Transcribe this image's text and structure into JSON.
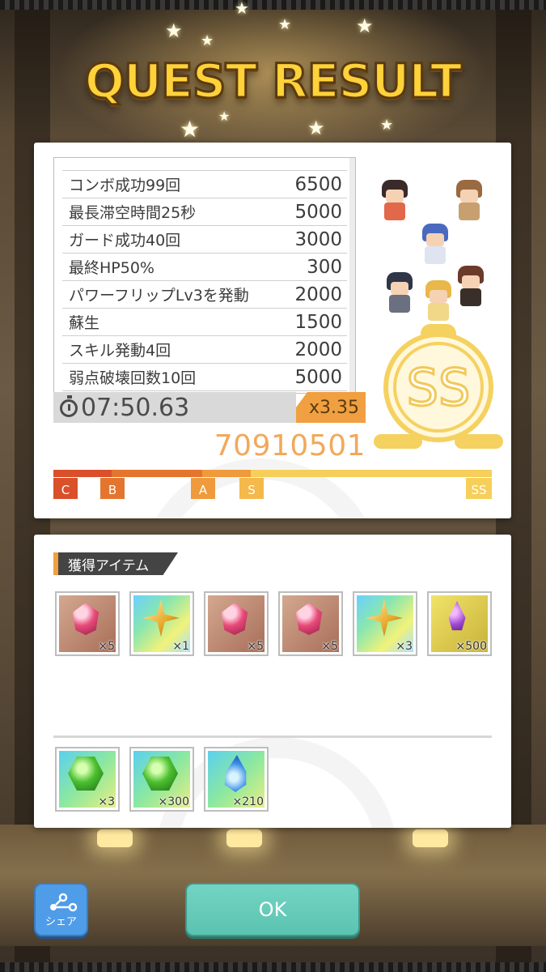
{
  "title": "QUEST RESULT",
  "score_entries": [
    {
      "label": "コンボ成功99回",
      "value": "6500"
    },
    {
      "label": "最長滞空時間25秒",
      "value": "5000"
    },
    {
      "label": "ガード成功40回",
      "value": "3000"
    },
    {
      "label": "最終HP50%",
      "value": "300"
    },
    {
      "label": "パワーフリップLv3を発動",
      "value": "2000"
    },
    {
      "label": "蘇生",
      "value": "1500"
    },
    {
      "label": "スキル発動4回",
      "value": "2000"
    },
    {
      "label": "弱点破壊回数10回",
      "value": "5000"
    }
  ],
  "clear_time": "07:50.63",
  "multiplier": "x3.35",
  "total_score": "70910501",
  "rank": {
    "achieved": "SS",
    "progress": 1.0,
    "levels": [
      "C",
      "B",
      "A",
      "S",
      "SS"
    ],
    "colors": {
      "C": "#d9502a",
      "B": "#e4752e",
      "A": "#ef9a3c",
      "S": "#f5b84a",
      "SS": "#f6cf5a"
    }
  },
  "items_section": {
    "label": "獲得アイテム",
    "items": [
      {
        "icon": "red-gem-icon",
        "tile": "brown",
        "count": "×5"
      },
      {
        "icon": "gold-star-icon",
        "tile": "rainbow",
        "count": "×1"
      },
      {
        "icon": "red-gem-icon",
        "tile": "brown",
        "count": "×5"
      },
      {
        "icon": "red-gem-icon",
        "tile": "brown",
        "count": "×5"
      },
      {
        "icon": "gold-star-icon",
        "tile": "rainbow",
        "count": "×3"
      },
      {
        "icon": "purple-gem-icon",
        "tile": "yellow",
        "count": "×500"
      }
    ],
    "extra_items": [
      {
        "icon": "green-gem-icon",
        "tile": "aqua",
        "count": "×3"
      },
      {
        "icon": "green-gem-icon",
        "tile": "aqua",
        "count": "×300"
      },
      {
        "icon": "blue-flame-icon",
        "tile": "aqua",
        "count": "×210"
      }
    ]
  },
  "buttons": {
    "share_label": "シェア",
    "ok_label": "OK"
  }
}
